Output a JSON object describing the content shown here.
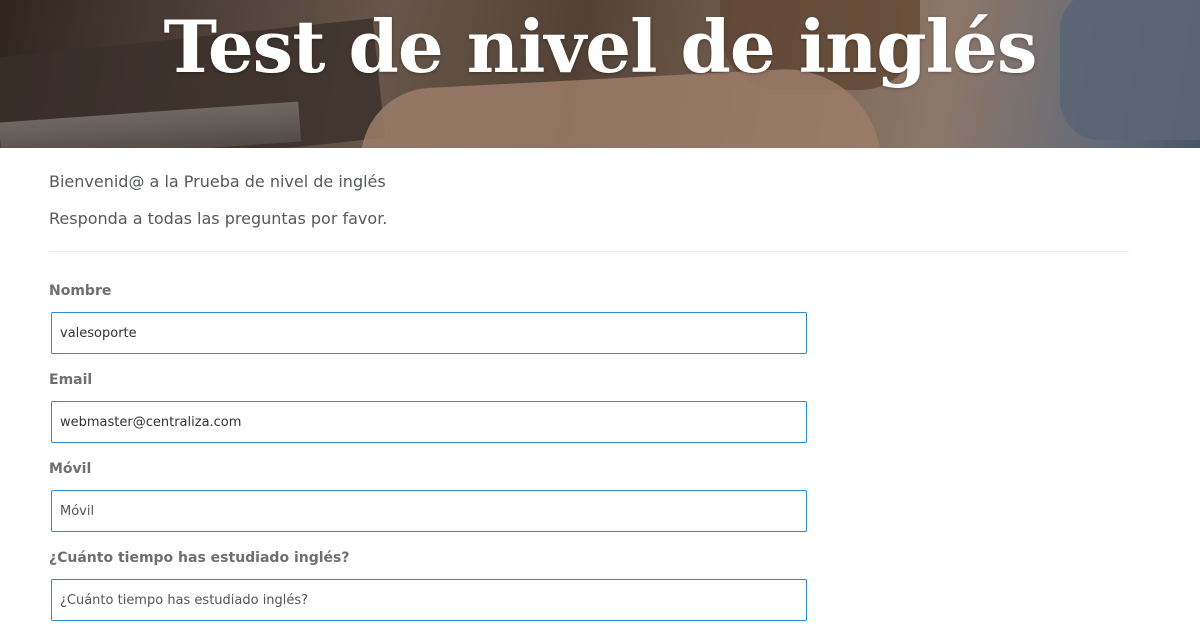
{
  "hero": {
    "title": "Test de nivel de inglés"
  },
  "intro": {
    "welcome": "Bienvenid@ a la Prueba de nivel de inglés",
    "instruction": "Responda a todas las preguntas por favor."
  },
  "form": {
    "nombre": {
      "label": "Nombre",
      "value": "valesoporte",
      "placeholder": ""
    },
    "email": {
      "label": "Email",
      "value": "webmaster@centraliza.com",
      "placeholder": ""
    },
    "movil": {
      "label": "Móvil",
      "value": "",
      "placeholder": "Móvil"
    },
    "tiempo": {
      "label": "¿Cuánto tiempo has estudiado inglés?",
      "value": "",
      "placeholder": "¿Cuánto tiempo has estudiado inglés?"
    }
  },
  "colors": {
    "input_border": "#2b8ad6",
    "label_text": "#6f6f6f",
    "body_text": "#55595c"
  }
}
